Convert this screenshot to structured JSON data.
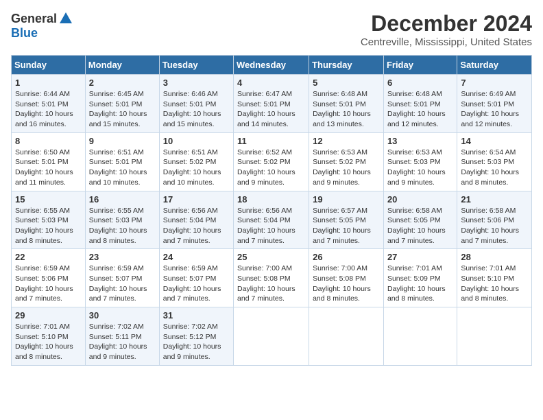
{
  "logo": {
    "general": "General",
    "blue": "Blue"
  },
  "title": "December 2024",
  "location": "Centreville, Mississippi, United States",
  "days_of_week": [
    "Sunday",
    "Monday",
    "Tuesday",
    "Wednesday",
    "Thursday",
    "Friday",
    "Saturday"
  ],
  "weeks": [
    [
      {
        "day": "1",
        "sunrise": "Sunrise: 6:44 AM",
        "sunset": "Sunset: 5:01 PM",
        "daylight": "Daylight: 10 hours and 16 minutes."
      },
      {
        "day": "2",
        "sunrise": "Sunrise: 6:45 AM",
        "sunset": "Sunset: 5:01 PM",
        "daylight": "Daylight: 10 hours and 15 minutes."
      },
      {
        "day": "3",
        "sunrise": "Sunrise: 6:46 AM",
        "sunset": "Sunset: 5:01 PM",
        "daylight": "Daylight: 10 hours and 15 minutes."
      },
      {
        "day": "4",
        "sunrise": "Sunrise: 6:47 AM",
        "sunset": "Sunset: 5:01 PM",
        "daylight": "Daylight: 10 hours and 14 minutes."
      },
      {
        "day": "5",
        "sunrise": "Sunrise: 6:48 AM",
        "sunset": "Sunset: 5:01 PM",
        "daylight": "Daylight: 10 hours and 13 minutes."
      },
      {
        "day": "6",
        "sunrise": "Sunrise: 6:48 AM",
        "sunset": "Sunset: 5:01 PM",
        "daylight": "Daylight: 10 hours and 12 minutes."
      },
      {
        "day": "7",
        "sunrise": "Sunrise: 6:49 AM",
        "sunset": "Sunset: 5:01 PM",
        "daylight": "Daylight: 10 hours and 12 minutes."
      }
    ],
    [
      {
        "day": "8",
        "sunrise": "Sunrise: 6:50 AM",
        "sunset": "Sunset: 5:01 PM",
        "daylight": "Daylight: 10 hours and 11 minutes."
      },
      {
        "day": "9",
        "sunrise": "Sunrise: 6:51 AM",
        "sunset": "Sunset: 5:01 PM",
        "daylight": "Daylight: 10 hours and 10 minutes."
      },
      {
        "day": "10",
        "sunrise": "Sunrise: 6:51 AM",
        "sunset": "Sunset: 5:02 PM",
        "daylight": "Daylight: 10 hours and 10 minutes."
      },
      {
        "day": "11",
        "sunrise": "Sunrise: 6:52 AM",
        "sunset": "Sunset: 5:02 PM",
        "daylight": "Daylight: 10 hours and 9 minutes."
      },
      {
        "day": "12",
        "sunrise": "Sunrise: 6:53 AM",
        "sunset": "Sunset: 5:02 PM",
        "daylight": "Daylight: 10 hours and 9 minutes."
      },
      {
        "day": "13",
        "sunrise": "Sunrise: 6:53 AM",
        "sunset": "Sunset: 5:03 PM",
        "daylight": "Daylight: 10 hours and 9 minutes."
      },
      {
        "day": "14",
        "sunrise": "Sunrise: 6:54 AM",
        "sunset": "Sunset: 5:03 PM",
        "daylight": "Daylight: 10 hours and 8 minutes."
      }
    ],
    [
      {
        "day": "15",
        "sunrise": "Sunrise: 6:55 AM",
        "sunset": "Sunset: 5:03 PM",
        "daylight": "Daylight: 10 hours and 8 minutes."
      },
      {
        "day": "16",
        "sunrise": "Sunrise: 6:55 AM",
        "sunset": "Sunset: 5:03 PM",
        "daylight": "Daylight: 10 hours and 8 minutes."
      },
      {
        "day": "17",
        "sunrise": "Sunrise: 6:56 AM",
        "sunset": "Sunset: 5:04 PM",
        "daylight": "Daylight: 10 hours and 7 minutes."
      },
      {
        "day": "18",
        "sunrise": "Sunrise: 6:56 AM",
        "sunset": "Sunset: 5:04 PM",
        "daylight": "Daylight: 10 hours and 7 minutes."
      },
      {
        "day": "19",
        "sunrise": "Sunrise: 6:57 AM",
        "sunset": "Sunset: 5:05 PM",
        "daylight": "Daylight: 10 hours and 7 minutes."
      },
      {
        "day": "20",
        "sunrise": "Sunrise: 6:58 AM",
        "sunset": "Sunset: 5:05 PM",
        "daylight": "Daylight: 10 hours and 7 minutes."
      },
      {
        "day": "21",
        "sunrise": "Sunrise: 6:58 AM",
        "sunset": "Sunset: 5:06 PM",
        "daylight": "Daylight: 10 hours and 7 minutes."
      }
    ],
    [
      {
        "day": "22",
        "sunrise": "Sunrise: 6:59 AM",
        "sunset": "Sunset: 5:06 PM",
        "daylight": "Daylight: 10 hours and 7 minutes."
      },
      {
        "day": "23",
        "sunrise": "Sunrise: 6:59 AM",
        "sunset": "Sunset: 5:07 PM",
        "daylight": "Daylight: 10 hours and 7 minutes."
      },
      {
        "day": "24",
        "sunrise": "Sunrise: 6:59 AM",
        "sunset": "Sunset: 5:07 PM",
        "daylight": "Daylight: 10 hours and 7 minutes."
      },
      {
        "day": "25",
        "sunrise": "Sunrise: 7:00 AM",
        "sunset": "Sunset: 5:08 PM",
        "daylight": "Daylight: 10 hours and 7 minutes."
      },
      {
        "day": "26",
        "sunrise": "Sunrise: 7:00 AM",
        "sunset": "Sunset: 5:08 PM",
        "daylight": "Daylight: 10 hours and 8 minutes."
      },
      {
        "day": "27",
        "sunrise": "Sunrise: 7:01 AM",
        "sunset": "Sunset: 5:09 PM",
        "daylight": "Daylight: 10 hours and 8 minutes."
      },
      {
        "day": "28",
        "sunrise": "Sunrise: 7:01 AM",
        "sunset": "Sunset: 5:10 PM",
        "daylight": "Daylight: 10 hours and 8 minutes."
      }
    ],
    [
      {
        "day": "29",
        "sunrise": "Sunrise: 7:01 AM",
        "sunset": "Sunset: 5:10 PM",
        "daylight": "Daylight: 10 hours and 8 minutes."
      },
      {
        "day": "30",
        "sunrise": "Sunrise: 7:02 AM",
        "sunset": "Sunset: 5:11 PM",
        "daylight": "Daylight: 10 hours and 9 minutes."
      },
      {
        "day": "31",
        "sunrise": "Sunrise: 7:02 AM",
        "sunset": "Sunset: 5:12 PM",
        "daylight": "Daylight: 10 hours and 9 minutes."
      },
      null,
      null,
      null,
      null
    ]
  ]
}
